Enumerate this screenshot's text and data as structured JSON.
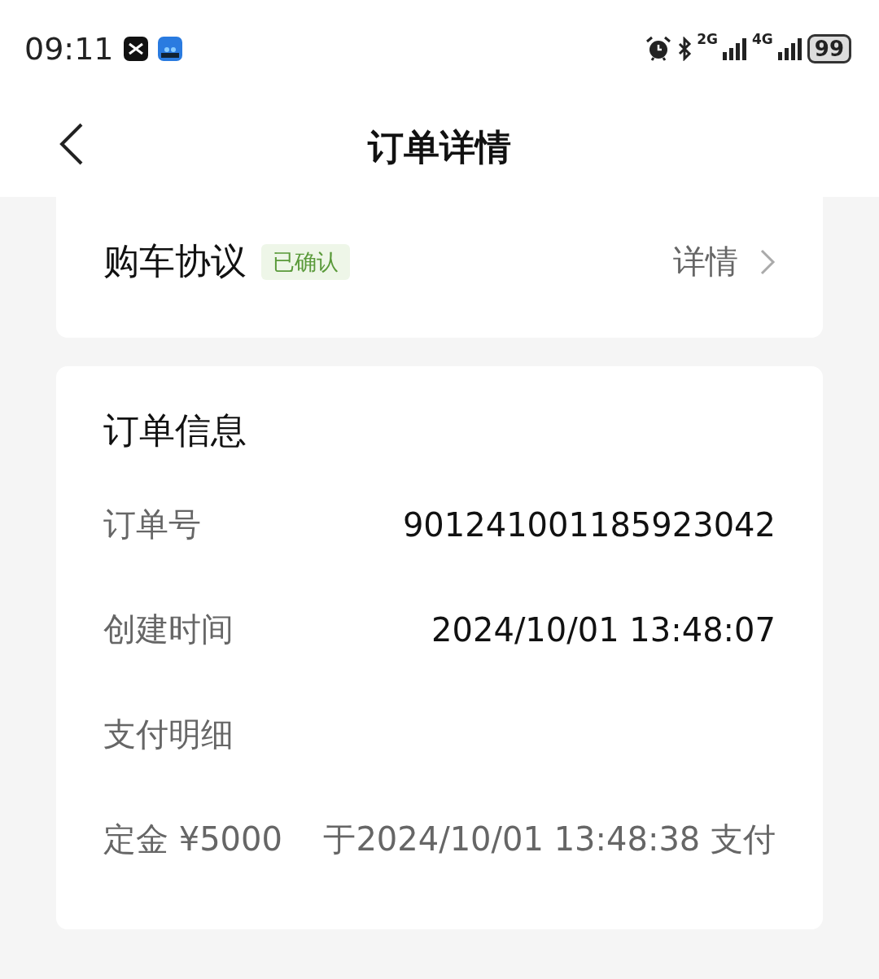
{
  "status_bar": {
    "time": "09:11",
    "network_1": "2G",
    "network_2": "4G",
    "battery": "99"
  },
  "header": {
    "title": "订单详情"
  },
  "agreement": {
    "label": "购车协议",
    "badge": "已确认",
    "link": "详情"
  },
  "order_info": {
    "title": "订单信息",
    "rows": [
      {
        "label": "订单号",
        "value": "901241001185923042",
        "kind": "dark"
      },
      {
        "label": "创建时间",
        "value": "2024/10/01 13:48:07",
        "kind": "dark"
      },
      {
        "label": "支付明细",
        "kind": "heading"
      },
      {
        "label": "定金 ¥5000",
        "value": "于2024/10/01 13:48:38 支付",
        "kind": "muted"
      }
    ]
  }
}
